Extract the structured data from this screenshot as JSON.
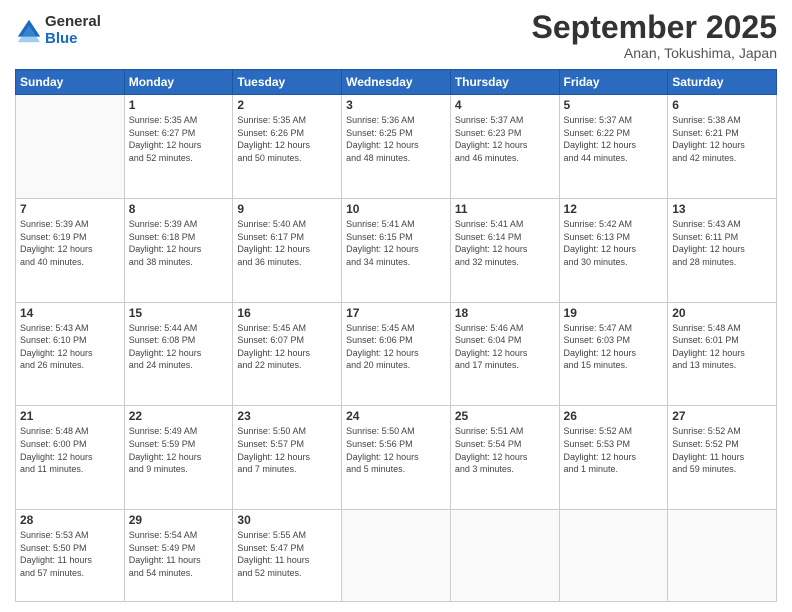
{
  "logo": {
    "general": "General",
    "blue": "Blue"
  },
  "header": {
    "month": "September 2025",
    "location": "Anan, Tokushima, Japan"
  },
  "weekdays": [
    "Sunday",
    "Monday",
    "Tuesday",
    "Wednesday",
    "Thursday",
    "Friday",
    "Saturday"
  ],
  "weeks": [
    [
      {
        "day": null
      },
      {
        "day": "1",
        "sunrise": "5:35 AM",
        "sunset": "6:27 PM",
        "daylight": "12 hours and 52 minutes."
      },
      {
        "day": "2",
        "sunrise": "5:35 AM",
        "sunset": "6:26 PM",
        "daylight": "12 hours and 50 minutes."
      },
      {
        "day": "3",
        "sunrise": "5:36 AM",
        "sunset": "6:25 PM",
        "daylight": "12 hours and 48 minutes."
      },
      {
        "day": "4",
        "sunrise": "5:37 AM",
        "sunset": "6:23 PM",
        "daylight": "12 hours and 46 minutes."
      },
      {
        "day": "5",
        "sunrise": "5:37 AM",
        "sunset": "6:22 PM",
        "daylight": "12 hours and 44 minutes."
      },
      {
        "day": "6",
        "sunrise": "5:38 AM",
        "sunset": "6:21 PM",
        "daylight": "12 hours and 42 minutes."
      }
    ],
    [
      {
        "day": "7",
        "sunrise": "5:39 AM",
        "sunset": "6:19 PM",
        "daylight": "12 hours and 40 minutes."
      },
      {
        "day": "8",
        "sunrise": "5:39 AM",
        "sunset": "6:18 PM",
        "daylight": "12 hours and 38 minutes."
      },
      {
        "day": "9",
        "sunrise": "5:40 AM",
        "sunset": "6:17 PM",
        "daylight": "12 hours and 36 minutes."
      },
      {
        "day": "10",
        "sunrise": "5:41 AM",
        "sunset": "6:15 PM",
        "daylight": "12 hours and 34 minutes."
      },
      {
        "day": "11",
        "sunrise": "5:41 AM",
        "sunset": "6:14 PM",
        "daylight": "12 hours and 32 minutes."
      },
      {
        "day": "12",
        "sunrise": "5:42 AM",
        "sunset": "6:13 PM",
        "daylight": "12 hours and 30 minutes."
      },
      {
        "day": "13",
        "sunrise": "5:43 AM",
        "sunset": "6:11 PM",
        "daylight": "12 hours and 28 minutes."
      }
    ],
    [
      {
        "day": "14",
        "sunrise": "5:43 AM",
        "sunset": "6:10 PM",
        "daylight": "12 hours and 26 minutes."
      },
      {
        "day": "15",
        "sunrise": "5:44 AM",
        "sunset": "6:08 PM",
        "daylight": "12 hours and 24 minutes."
      },
      {
        "day": "16",
        "sunrise": "5:45 AM",
        "sunset": "6:07 PM",
        "daylight": "12 hours and 22 minutes."
      },
      {
        "day": "17",
        "sunrise": "5:45 AM",
        "sunset": "6:06 PM",
        "daylight": "12 hours and 20 minutes."
      },
      {
        "day": "18",
        "sunrise": "5:46 AM",
        "sunset": "6:04 PM",
        "daylight": "12 hours and 17 minutes."
      },
      {
        "day": "19",
        "sunrise": "5:47 AM",
        "sunset": "6:03 PM",
        "daylight": "12 hours and 15 minutes."
      },
      {
        "day": "20",
        "sunrise": "5:48 AM",
        "sunset": "6:01 PM",
        "daylight": "12 hours and 13 minutes."
      }
    ],
    [
      {
        "day": "21",
        "sunrise": "5:48 AM",
        "sunset": "6:00 PM",
        "daylight": "12 hours and 11 minutes."
      },
      {
        "day": "22",
        "sunrise": "5:49 AM",
        "sunset": "5:59 PM",
        "daylight": "12 hours and 9 minutes."
      },
      {
        "day": "23",
        "sunrise": "5:50 AM",
        "sunset": "5:57 PM",
        "daylight": "12 hours and 7 minutes."
      },
      {
        "day": "24",
        "sunrise": "5:50 AM",
        "sunset": "5:56 PM",
        "daylight": "12 hours and 5 minutes."
      },
      {
        "day": "25",
        "sunrise": "5:51 AM",
        "sunset": "5:54 PM",
        "daylight": "12 hours and 3 minutes."
      },
      {
        "day": "26",
        "sunrise": "5:52 AM",
        "sunset": "5:53 PM",
        "daylight": "12 hours and 1 minute."
      },
      {
        "day": "27",
        "sunrise": "5:52 AM",
        "sunset": "5:52 PM",
        "daylight": "11 hours and 59 minutes."
      }
    ],
    [
      {
        "day": "28",
        "sunrise": "5:53 AM",
        "sunset": "5:50 PM",
        "daylight": "11 hours and 57 minutes."
      },
      {
        "day": "29",
        "sunrise": "5:54 AM",
        "sunset": "5:49 PM",
        "daylight": "11 hours and 54 minutes."
      },
      {
        "day": "30",
        "sunrise": "5:55 AM",
        "sunset": "5:47 PM",
        "daylight": "11 hours and 52 minutes."
      },
      {
        "day": null
      },
      {
        "day": null
      },
      {
        "day": null
      },
      {
        "day": null
      }
    ]
  ]
}
